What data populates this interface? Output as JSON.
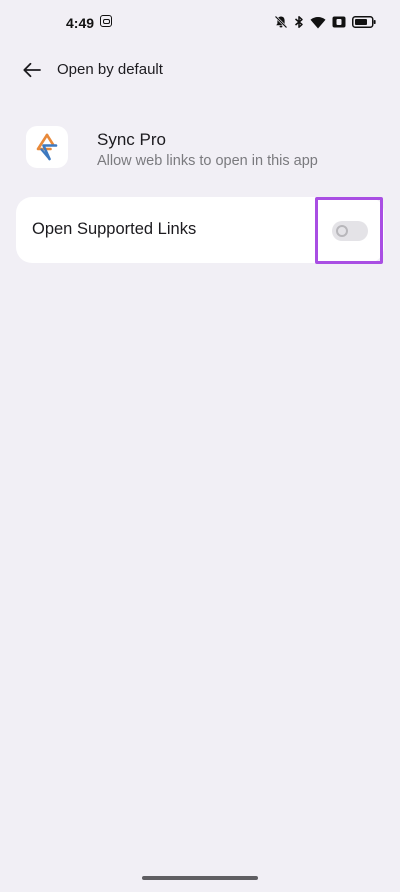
{
  "status_bar": {
    "time": "4:49",
    "icons": [
      "bell-muted-icon",
      "bluetooth-icon",
      "wifi-icon",
      "sim-icon",
      "battery-icon"
    ]
  },
  "app_bar": {
    "back_icon": "arrow-left-icon",
    "title": "Open by default"
  },
  "app": {
    "name": "Sync Pro",
    "description": "Allow web links to open in this app",
    "icon": "sync-pro-logo-icon",
    "icon_colors": [
      "#e8893a",
      "#3d79c0"
    ]
  },
  "setting": {
    "label": "Open Supported Links",
    "enabled": false
  },
  "colors": {
    "background": "#f1eff5",
    "card": "#ffffff",
    "highlight": "#a94ee3",
    "toggle_off": "#e4e3e7"
  }
}
